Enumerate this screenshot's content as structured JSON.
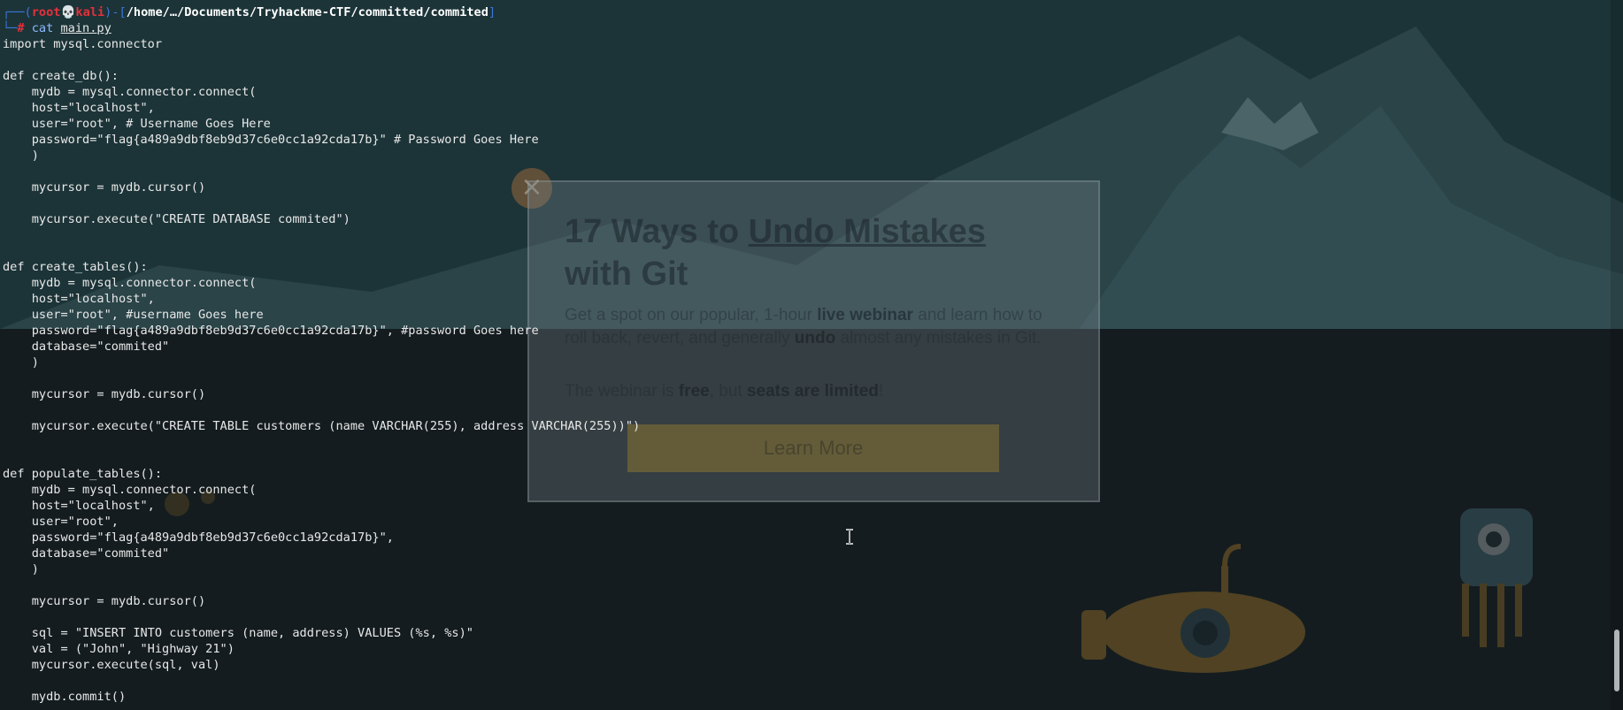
{
  "terminal": {
    "prompt": {
      "open": "┌──(",
      "user": "root💀kali",
      "mid": ")-[",
      "path": "/home/…/Documents/Tryhackme-CTF/committed/commited",
      "close": "]",
      "line2_prefix": "└─",
      "hash": "# ",
      "command": "cat",
      "argument": "main.py"
    },
    "lines": [
      "import mysql.connector",
      "",
      "def create_db():",
      "    mydb = mysql.connector.connect(",
      "    host=\"localhost\",",
      "    user=\"root\", # Username Goes Here",
      "    password=\"flag{a489a9dbf8eb9d37c6e0cc1a92cda17b}\" # Password Goes Here",
      "    )",
      "",
      "    mycursor = mydb.cursor()",
      "",
      "    mycursor.execute(\"CREATE DATABASE commited\")",
      "",
      "",
      "def create_tables():",
      "    mydb = mysql.connector.connect(",
      "    host=\"localhost\",",
      "    user=\"root\", #username Goes here",
      "    password=\"flag{a489a9dbf8eb9d37c6e0cc1a92cda17b}\", #password Goes here",
      "    database=\"commited\"",
      "    )",
      "",
      "    mycursor = mydb.cursor()",
      "",
      "    mycursor.execute(\"CREATE TABLE customers (name VARCHAR(255), address VARCHAR(255))\")",
      "",
      "",
      "def populate_tables():",
      "    mydb = mysql.connector.connect(",
      "    host=\"localhost\",",
      "    user=\"root\",",
      "    password=\"flag{a489a9dbf8eb9d37c6e0cc1a92cda17b}\",",
      "    database=\"commited\"",
      "    )",
      "",
      "    mycursor = mydb.cursor()",
      "",
      "    sql = \"INSERT INTO customers (name, address) VALUES (%s, %s)\"",
      "    val = (\"John\", \"Highway 21\")",
      "    mycursor.execute(sql, val)",
      "",
      "    mydb.commit()"
    ]
  },
  "popup": {
    "close_glyph": "×",
    "title_prefix": "17 Ways to ",
    "title_link": "Undo Mistakes",
    "title_suffix": " with Git",
    "desc_1": "Get a spot on our popular, 1-hour ",
    "desc_bold_1": "live webinar",
    "desc_2": " and learn how to roll back, revert, and generally ",
    "desc_bold_2": "undo",
    "desc_3": " almost any mistakes in Git.",
    "note_1": "The webinar is ",
    "note_bold_1": "free",
    "note_2": ", but ",
    "note_bold_2": "seats are limited",
    "note_3": "!",
    "cta": "Learn More"
  },
  "icons": {
    "cursor": "text-ibeam-cursor-icon"
  },
  "colors": {
    "prompt_user": "#e5303b",
    "prompt_bracket": "#3a76d6",
    "terminal_text": "#e8e8e8"
  }
}
